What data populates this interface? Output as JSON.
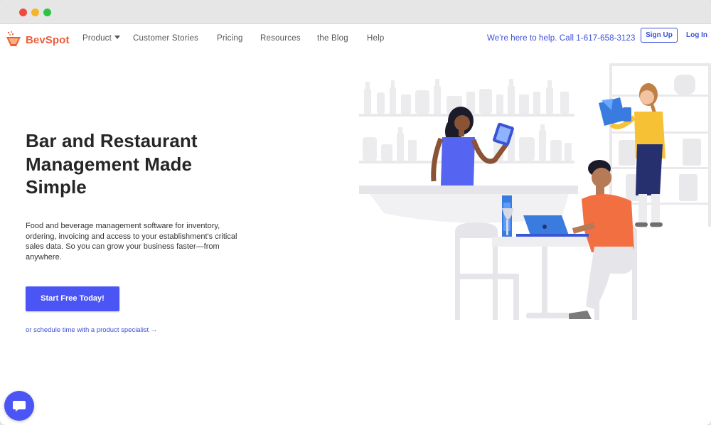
{
  "browser": {
    "controls": [
      "close",
      "minimize",
      "maximize"
    ]
  },
  "brand": {
    "name": "BevSpot",
    "color": "#ee5d3a",
    "accent": "#4b55f5",
    "link": "#3b4fd8"
  },
  "nav": {
    "items": [
      "Product",
      "Customer Stories",
      "Pricing",
      "Resources",
      "the Blog",
      "Help"
    ],
    "help_text": "We're here to help. Call 1-617-658-3123",
    "signup_label": "Sign Up",
    "login_label": "Log In"
  },
  "hero": {
    "title_lines": [
      "Bar and Restaurant",
      "Management Made",
      "Simple"
    ],
    "description": "Food and beverage management software for inventory, ordering, invoicing and access to your establishment's critical sales data. So you can grow your business faster—from anywhere.",
    "cta_label": "Start Free Today!",
    "schedule_link": "or schedule time with a product specialist →"
  },
  "chat": {
    "icon": "chat-bubble-icon"
  }
}
